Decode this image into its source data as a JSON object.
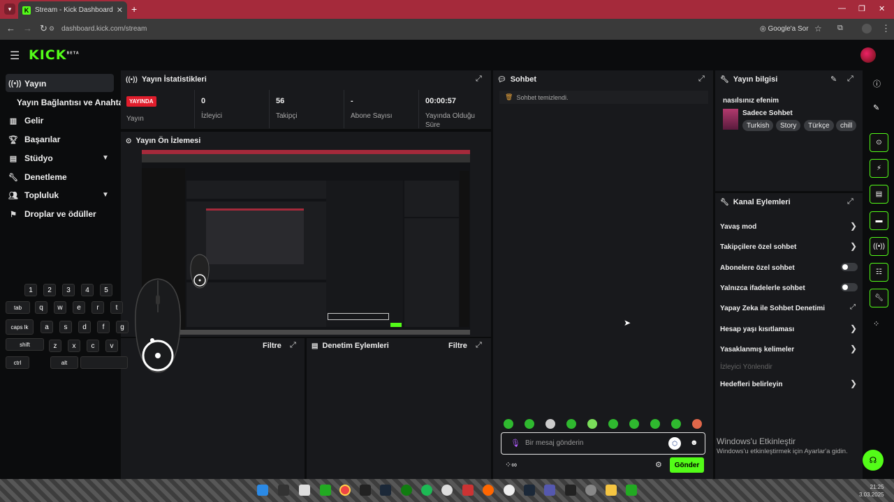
{
  "browser": {
    "tab_title": "Stream - Kick Dashboard",
    "url": "dashboard.kick.com/stream",
    "google_ask": "Google'a Sor"
  },
  "brand": {
    "logo": "KICK",
    "beta": "BETA",
    "accent": "#53fc18"
  },
  "sidebar": {
    "items": [
      {
        "label": "Yayın",
        "icon": "broadcast-icon"
      },
      {
        "label": "Yayın Bağlantısı ve Anahtarı"
      },
      {
        "label": "Gelir",
        "icon": "chart-icon"
      },
      {
        "label": "Başarılar",
        "icon": "trophy-icon"
      },
      {
        "label": "Stüdyo",
        "icon": "studio-icon"
      },
      {
        "label": "Denetleme",
        "icon": "wrench-icon"
      },
      {
        "label": "Topluluk",
        "icon": "users-icon"
      },
      {
        "label": "Droplar ve ödüller",
        "icon": "gift-icon"
      }
    ]
  },
  "stats": {
    "title": "Yayın İstatistikleri",
    "live_badge": "YAYINDA",
    "live_label": "Yayın",
    "viewers_value": "0",
    "viewers_label": "İzleyici",
    "followers_value": "56",
    "followers_label": "Takipçi",
    "subs_value": "-",
    "subs_label": "Abone Sayısı",
    "duration_value": "00:00:57",
    "duration_label": "Yayında Olduğu Süre"
  },
  "preview": {
    "title": "Yayın Ön İzlemesi"
  },
  "keyboard": {
    "numbers": [
      "1",
      "2",
      "3",
      "4",
      "5"
    ],
    "row_tab": [
      "tab",
      "q",
      "w",
      "e",
      "r",
      "t"
    ],
    "row_caps": [
      "caps lk",
      "a",
      "s",
      "d",
      "f",
      "g"
    ],
    "row_shift": [
      "shift",
      "z",
      "x",
      "c",
      "v"
    ],
    "row_ctrl": [
      "ctrl",
      "alt"
    ]
  },
  "lower_panels": {
    "filter_label": "Filtre",
    "mod_actions_title": "Denetim Eylemleri"
  },
  "chat": {
    "title": "Sohbet",
    "notice": "Sohbet temizlendi.",
    "input_placeholder": "Bir mesaj gönderin",
    "send_label": "Gönder"
  },
  "stream_info": {
    "title": "Yayın bilgisi",
    "stream_title": "nasılsınız efenim",
    "category": "Sadece Sohbet",
    "tags": [
      "Turkish",
      "Story",
      "Türkçe",
      "chill"
    ]
  },
  "channel_actions": {
    "title": "Kanal Eylemleri",
    "slow_mode": "Yavaş mod",
    "followers_only": "Takipçilere özel sohbet",
    "subs_only": "Abonelere özel sohbet",
    "emotes_only": "Yalnızca ifadelerle sohbet",
    "ai_moderation": "Yapay Zeka ile Sohbet Denetimi",
    "account_age": "Hesap yaşı kısıtlaması",
    "banned_words": "Yasaklanmış kelimeler",
    "redirect_viewers": "İzleyici Yönlendir",
    "set_goals": "Hedefleri belirleyin"
  },
  "windows_activation": {
    "line1": "Windows'u Etkinleştir",
    "line2": "Windows'u etkinleştirmek için Ayarlar'a gidin."
  },
  "clock": {
    "time": "21:25",
    "date": "3.03.2025"
  }
}
